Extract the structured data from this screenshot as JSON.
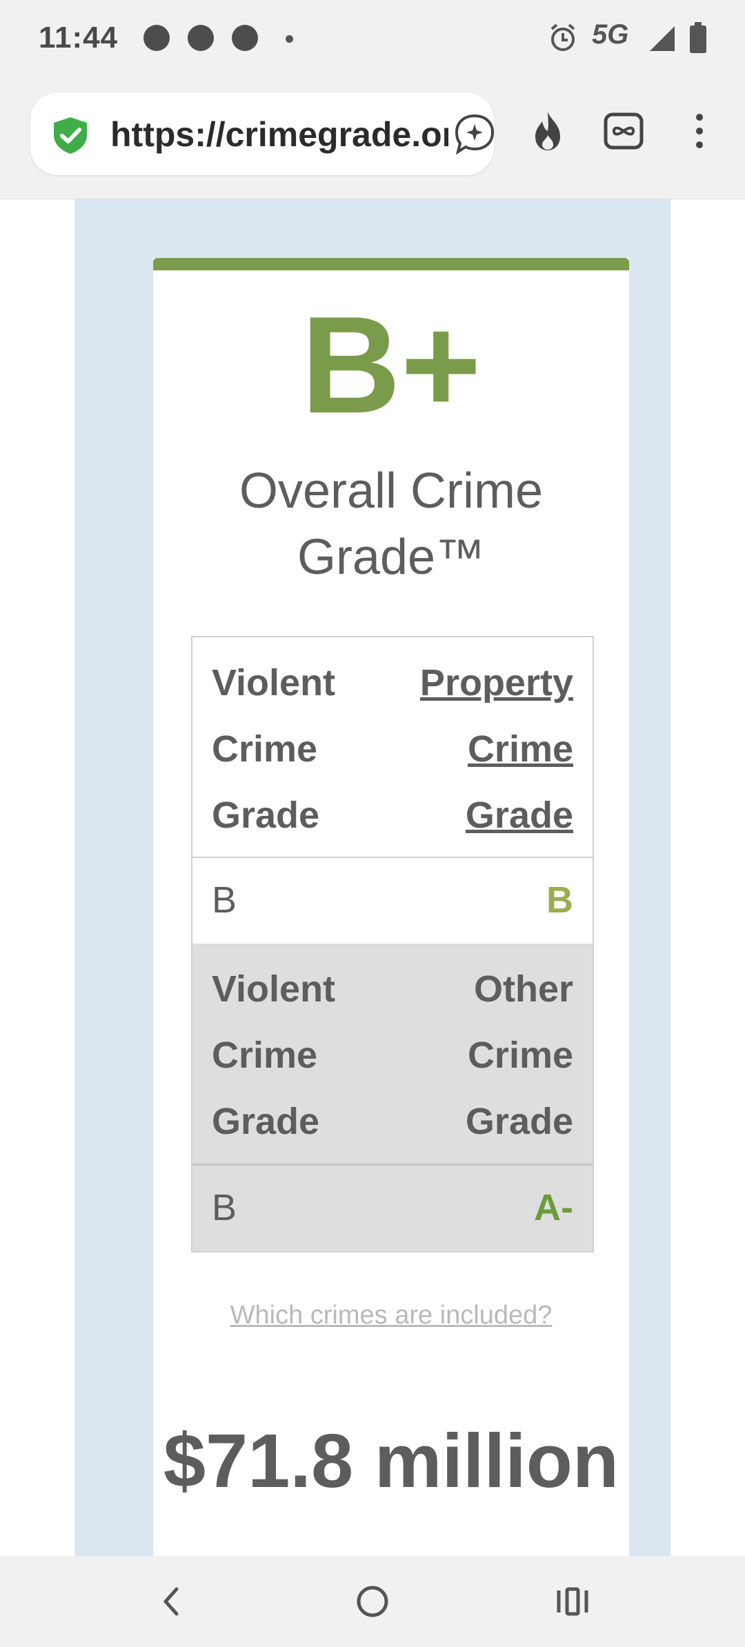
{
  "status_bar": {
    "time": "11:44",
    "network": "5G",
    "left_icons": [
      "messenger-icon",
      "messenger-icon",
      "facebook-icon",
      "dot-icon"
    ],
    "right_icons": [
      "alarm-icon",
      "signal-icon",
      "battery-icon"
    ]
  },
  "browser": {
    "url": "https://crimegrade.org",
    "icons": [
      "shield-check-icon",
      "ai-chat-icon",
      "flame-icon",
      "infinity-tab-icon",
      "more-vert-icon"
    ]
  },
  "card": {
    "accent_color": "#7c9c4b",
    "overall_grade": "B+",
    "overall_title": "Overall Crime Grade™",
    "table": {
      "row1": {
        "left_header": "Violent Crime Grade",
        "right_header": "Property Crime Grade",
        "left_value": "B",
        "right_value": "B",
        "right_value_color": "#9aad52"
      },
      "row2": {
        "left_header": "Violent Crime Grade",
        "right_header": "Other Crime Grade",
        "left_value": "B",
        "right_value": "A-",
        "right_value_color": "#6b9b3c"
      }
    },
    "crimes_link": "Which crimes are included?",
    "cost_value": "$71.8 million"
  },
  "nav_bar": {
    "icons": [
      "back-icon",
      "home-icon",
      "recents-icon"
    ]
  }
}
